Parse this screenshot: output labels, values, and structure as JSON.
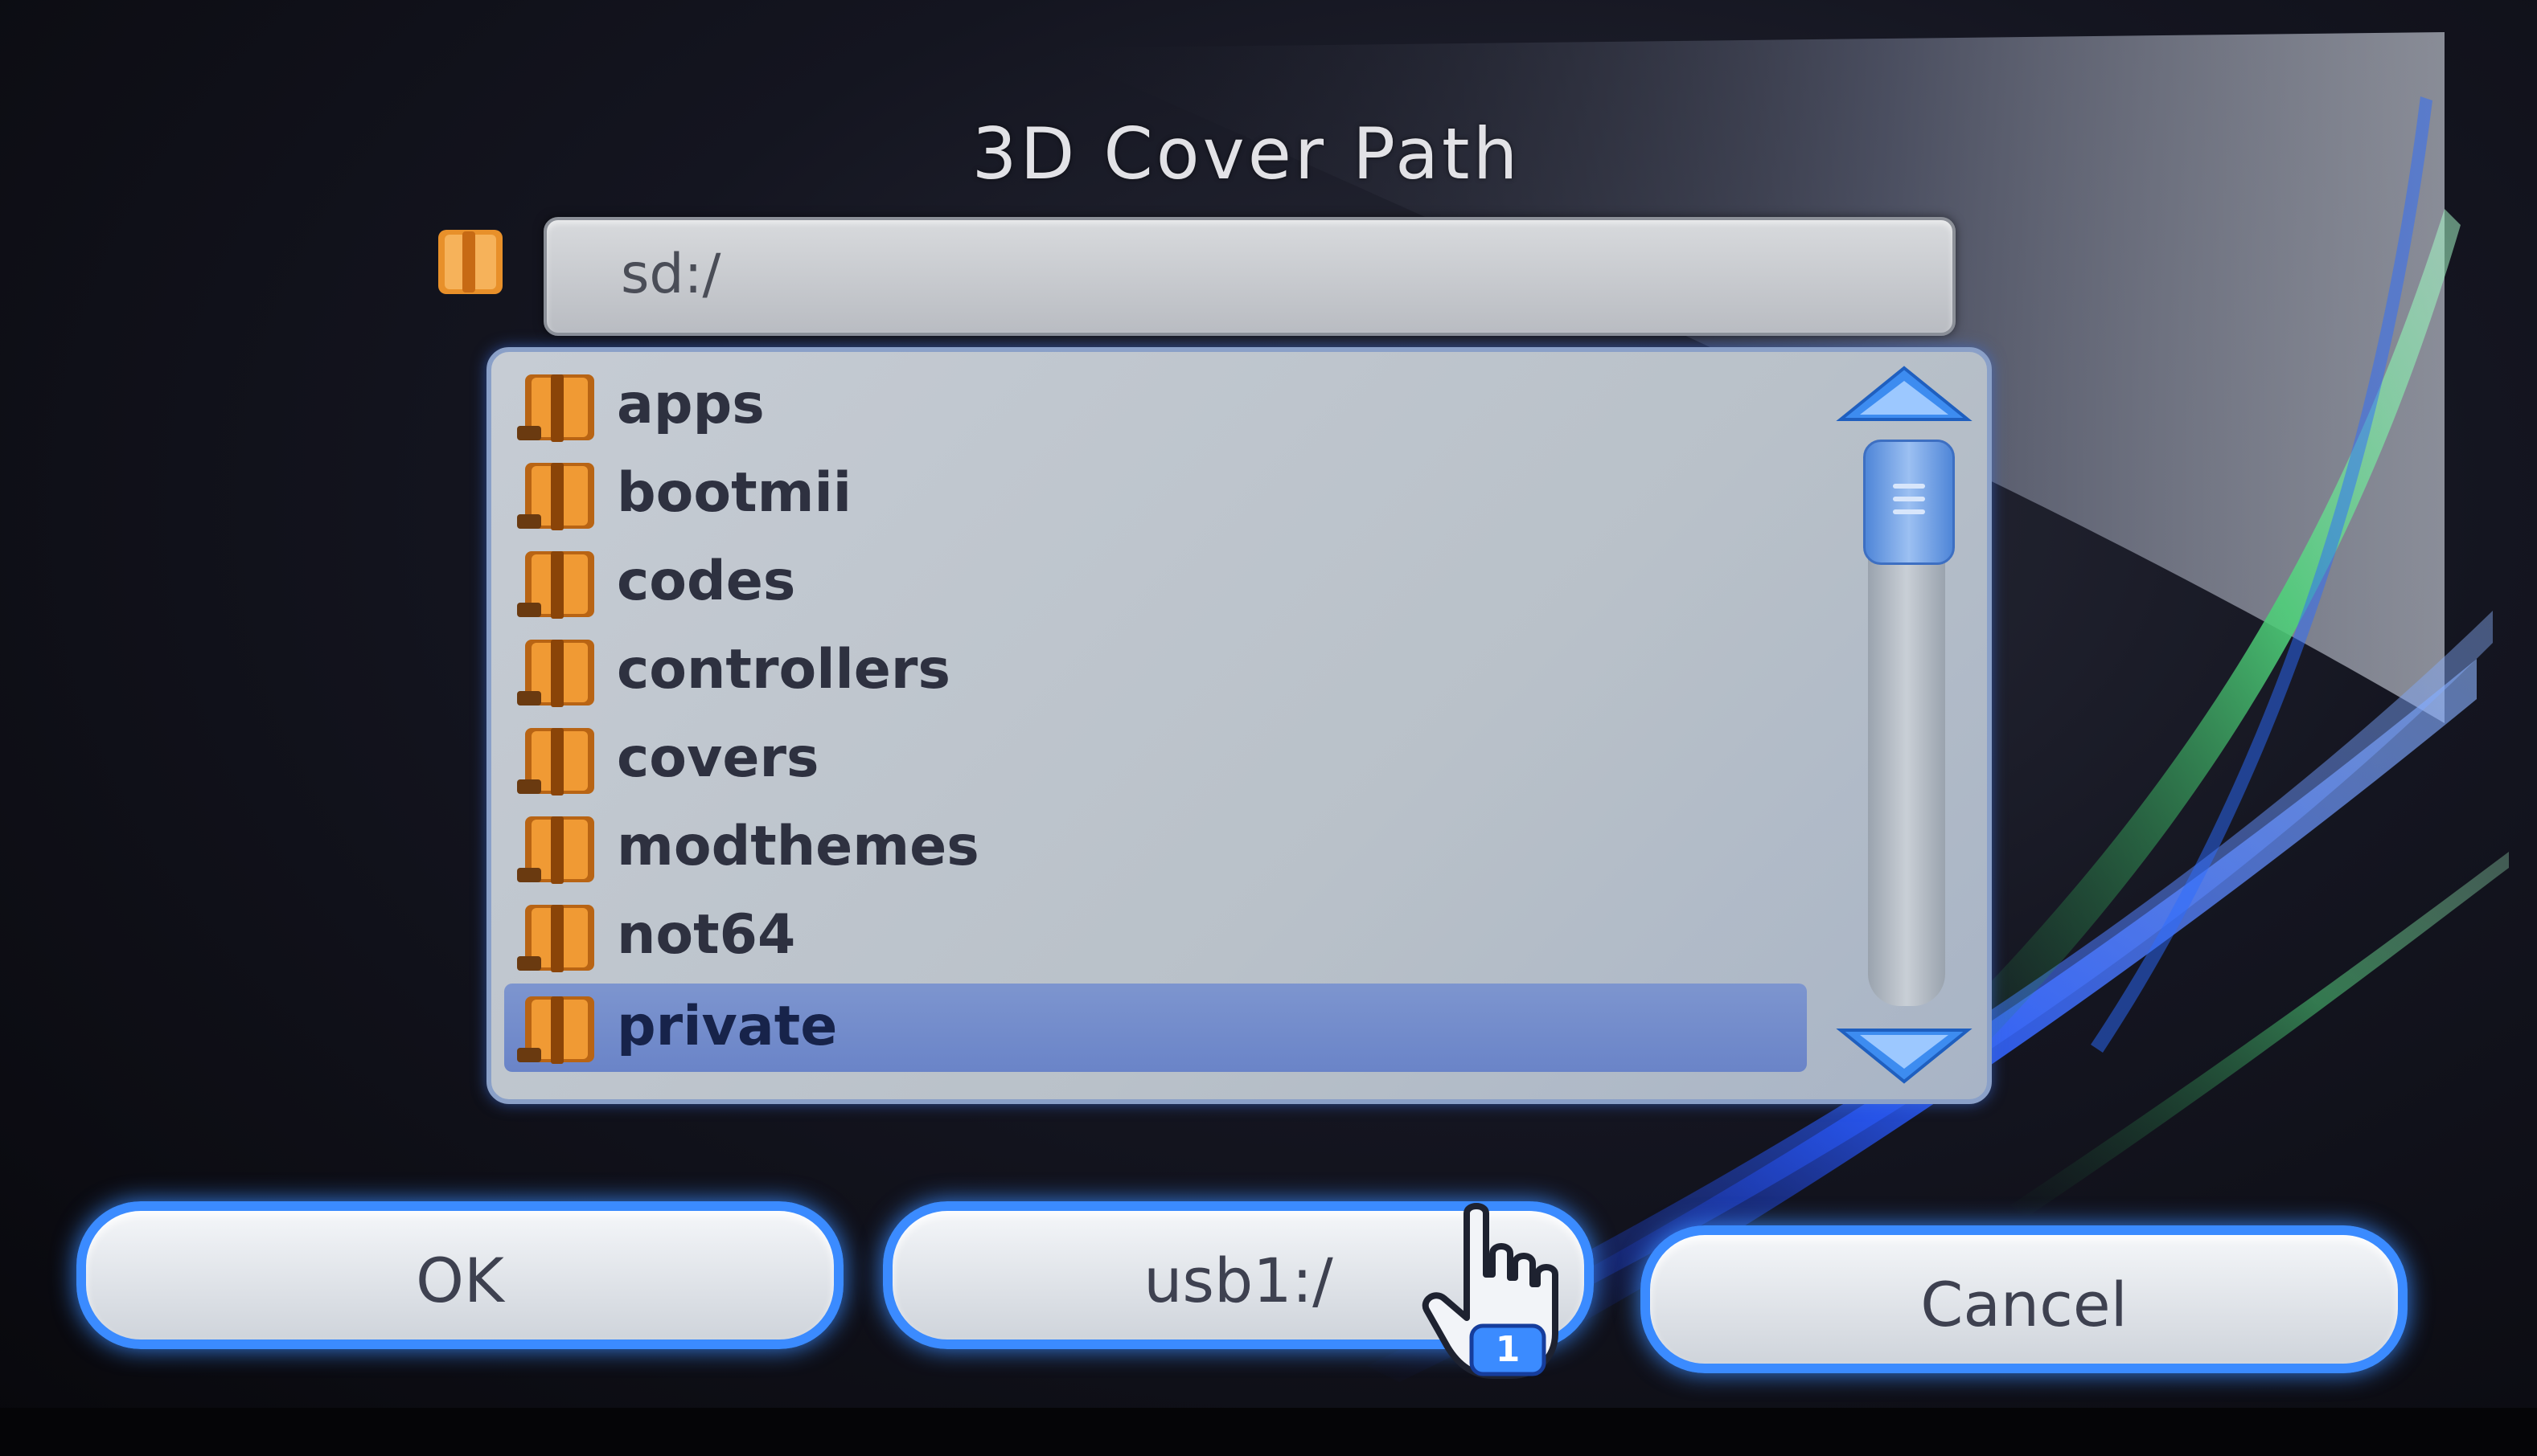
{
  "dialog": {
    "title": "3D Cover Path",
    "current_path": "sd:/"
  },
  "file_list": {
    "items": [
      {
        "label": "apps",
        "icon": "folder-icon",
        "selected": false
      },
      {
        "label": "bootmii",
        "icon": "folder-icon",
        "selected": false
      },
      {
        "label": "codes",
        "icon": "folder-icon",
        "selected": false
      },
      {
        "label": "controllers",
        "icon": "folder-icon",
        "selected": false
      },
      {
        "label": "covers",
        "icon": "folder-icon",
        "selected": false
      },
      {
        "label": "modthemes",
        "icon": "folder-icon",
        "selected": false
      },
      {
        "label": "not64",
        "icon": "folder-icon",
        "selected": false
      },
      {
        "label": "private",
        "icon": "folder-icon",
        "selected": true
      }
    ]
  },
  "buttons": {
    "ok": "OK",
    "device": "usb1:/",
    "cancel": "Cancel"
  },
  "pointer": {
    "player_number": "1",
    "icon": "hand-pointer-icon"
  },
  "colors": {
    "accent": "#3b8bff",
    "selection": "#6a84c8",
    "folder": "#e8902a",
    "background": "#0b0a10"
  }
}
